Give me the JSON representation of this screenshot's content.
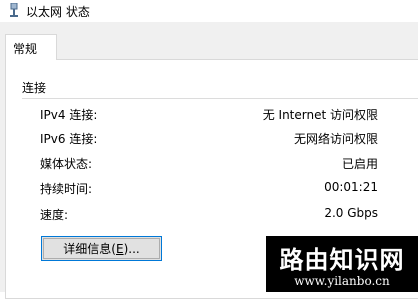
{
  "window": {
    "title": "以太网 状态"
  },
  "tabs": [
    {
      "label": "常规",
      "selected": true
    }
  ],
  "connection": {
    "group_title": "连接",
    "rows": [
      {
        "label": "IPv4 连接:",
        "value": "无 Internet 访问权限"
      },
      {
        "label": "IPv6 连接:",
        "value": "无网络访问权限"
      },
      {
        "label": "媒体状态:",
        "value": "已启用"
      },
      {
        "label": "持续时间:",
        "value": "00:01:21"
      },
      {
        "label": "速度:",
        "value": "2.0 Gbps"
      }
    ]
  },
  "buttons": {
    "details_prefix": "详细信息(",
    "details_key": "E",
    "details_suffix": ")..."
  },
  "watermark": {
    "main": "路由知识网",
    "sub": "www.yilanbo.cn"
  },
  "colors": {
    "focus_border": "#0078d7",
    "dialog_bg": "#f0f0f0"
  }
}
